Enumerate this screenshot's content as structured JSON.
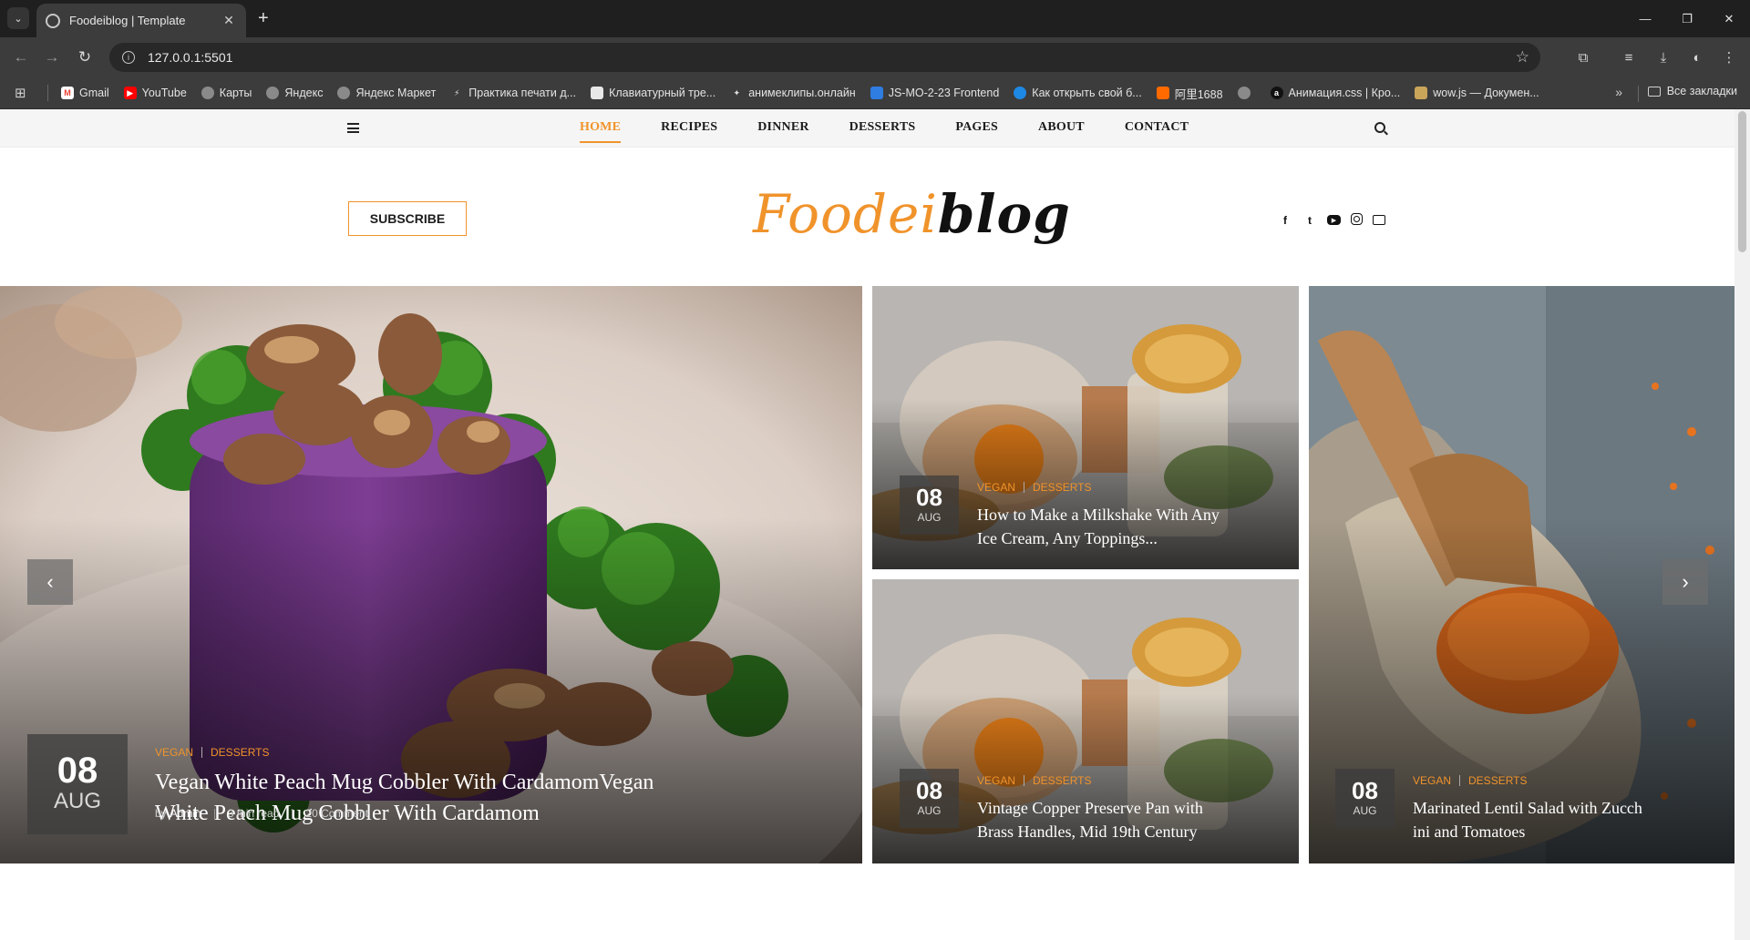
{
  "browser": {
    "tab_title": "Foodeiblog | Template",
    "new_tab": "+",
    "url": "127.0.0.1:5501",
    "window_controls": [
      "—",
      "❐",
      "✕"
    ]
  },
  "bookmarks": {
    "items": [
      {
        "label": "Gmail",
        "icon": "gmail-icon",
        "color": "#ea4335"
      },
      {
        "label": "YouTube",
        "icon": "youtube-icon",
        "color": "#ff0000"
      },
      {
        "label": "Карты",
        "icon": "globe-icon",
        "color": "#8a8a8a"
      },
      {
        "label": "Яндекс",
        "icon": "globe-icon",
        "color": "#8a8a8a"
      },
      {
        "label": "Яндекс Маркет",
        "icon": "globe-icon",
        "color": "#8a8a8a"
      },
      {
        "label": "Практика печати д...",
        "icon": "bolt-icon",
        "color": "#3c3c3c"
      },
      {
        "label": "Клавиатурный тре...",
        "icon": "page-icon",
        "color": "#e8e8e8"
      },
      {
        "label": "анимеклипы.онлайн",
        "icon": "anime-icon",
        "color": "#3c3c3c"
      },
      {
        "label": "JS-MO-2-23 Frontend",
        "icon": "classroom-icon",
        "color": "#2f7de1"
      },
      {
        "label": "Как открыть свой б...",
        "icon": "blue-circle-icon",
        "color": "#1e88e5"
      },
      {
        "label": "阿里1688",
        "icon": "alibaba-icon",
        "color": "#ff6a00"
      },
      {
        "label": "",
        "icon": "globe-icon",
        "color": "#8a8a8a"
      },
      {
        "label": "Анимация.css | Кро...",
        "icon": "a-icon",
        "color": "#111111"
      },
      {
        "label": "wow.js — Докумен...",
        "icon": "wow-icon",
        "color": "#c9a55a"
      }
    ],
    "more": "»",
    "all_bookmarks": "Все закладки"
  },
  "site": {
    "menu": [
      {
        "label": "HOME",
        "active": true
      },
      {
        "label": "RECIPES",
        "active": false
      },
      {
        "label": "DINNER",
        "active": false
      },
      {
        "label": "DESSERTS",
        "active": false
      },
      {
        "label": "PAGES",
        "active": false
      },
      {
        "label": "ABOUT",
        "active": false
      },
      {
        "label": "CONTACT",
        "active": false
      }
    ],
    "subscribe": "SUBSCRIBE",
    "logo_part1": "Foodei",
    "logo_part2": "blog",
    "accent": "#f0932b",
    "socials": [
      "facebook-icon",
      "twitter-icon",
      "youtube-icon",
      "instagram-icon",
      "mail-icon"
    ]
  },
  "slider": {
    "prev": "‹",
    "next": "›",
    "main": {
      "day": "08",
      "month": "AUG",
      "tag1": "VEGAN",
      "tag2": "DESSERTS",
      "title_line1": "Vegan White Peach Mug Cobbler With CardamomVegan",
      "title_line2": "White Peach Mug Cobbler With Cardamom",
      "by": "by",
      "author": "Admin",
      "read_time": "3 min read",
      "comments": "20 Comment"
    },
    "top_right": {
      "day": "08",
      "month": "AUG",
      "tag1": "VEGAN",
      "tag2": "DESSERTS",
      "title_line1": "How to Make a Milkshake With Any",
      "title_line2": "Ice Cream, Any Toppings..."
    },
    "bottom_right": {
      "day": "08",
      "month": "AUG",
      "tag1": "VEGAN",
      "tag2": "DESSERTS",
      "title_line1": "Vintage Copper Preserve Pan with",
      "title_line2": "Brass Handles, Mid 19th Century"
    },
    "far_right": {
      "day": "08",
      "month": "AUG",
      "tag1": "VEGAN",
      "tag2": "DESSERTS",
      "title_line1": "Marinated Lentil Salad with Zucch",
      "title_line2": "ini and Tomatoes"
    }
  }
}
